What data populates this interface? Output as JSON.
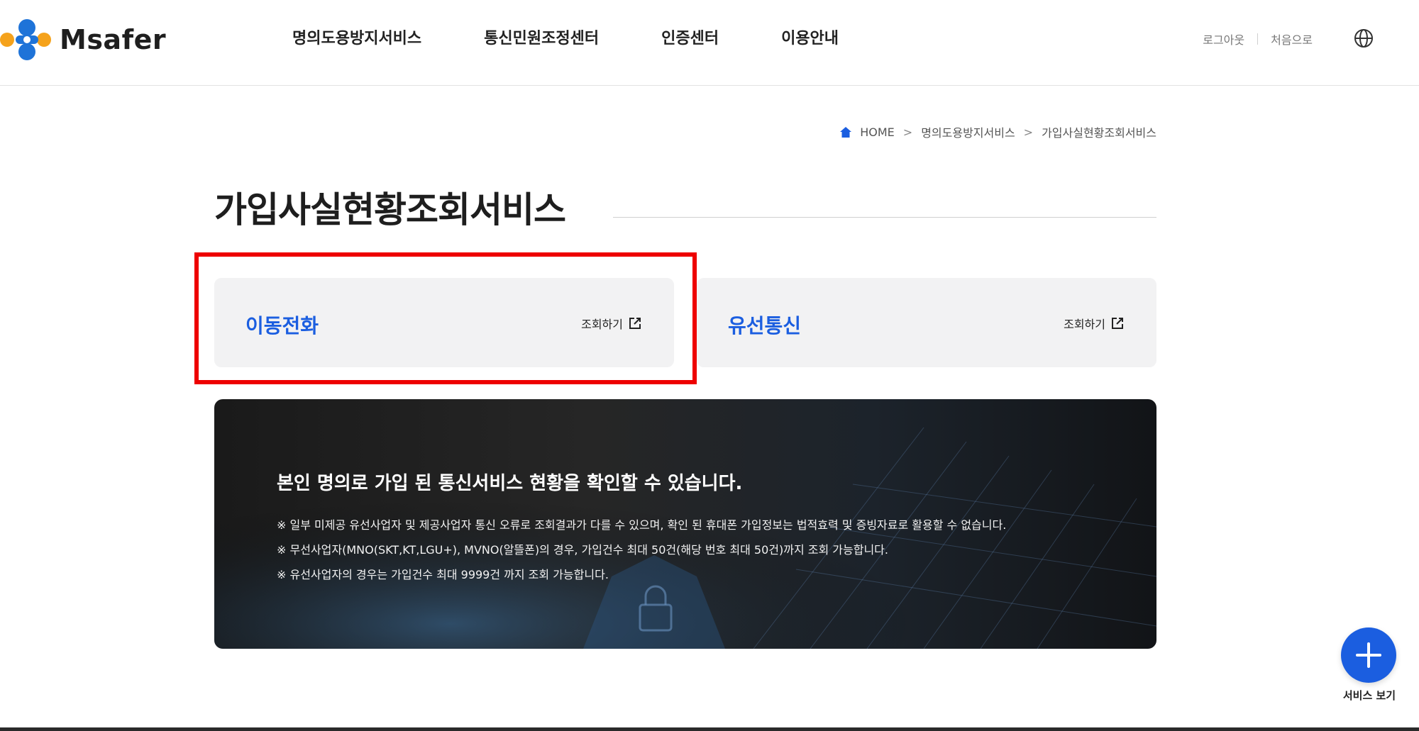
{
  "header": {
    "logo_text": "Msafer",
    "nav": [
      {
        "label": "명의도용방지서비스"
      },
      {
        "label": "통신민원조정센터"
      },
      {
        "label": "인증센터"
      },
      {
        "label": "이용안내"
      }
    ],
    "logout_label": "로그아웃",
    "home_label": "처음으로",
    "language_icon": "globe-icon"
  },
  "breadcrumb": {
    "home": "HOME",
    "level1": "명의도용방지서비스",
    "level2": "가입사실현황조회서비스",
    "separator": ">"
  },
  "page": {
    "title": "가입사실현황조회서비스"
  },
  "cards": [
    {
      "title": "이동전화",
      "link_label": "조회하기",
      "link_icon": "external-link-icon"
    },
    {
      "title": "유선통신",
      "link_label": "조회하기",
      "link_icon": "external-link-icon"
    }
  ],
  "banner": {
    "heading": "본인 명의로 가입 된 통신서비스 현황을 확인할 수 있습니다.",
    "notes": [
      "※ 일부 미제공 유선사업자 및 제공사업자 통신 오류로 조회결과가 다를 수 있으며, 확인 된 휴대폰 가입정보는 법적효력 및 증빙자료로 활용할 수 없습니다.",
      "※ 무선사업자(MNO(SKT,KT,LGU+), MVNO(알뜰폰)의 경우, 가입건수 최대 50건(해당 번호 최대 50건)까지 조회 가능합니다.",
      "※ 유선사업자의 경우는 가입건수 최대 9999건 까지 조회 가능합니다."
    ]
  },
  "fab": {
    "label": "서비스 보기",
    "icon": "plus-icon"
  },
  "colors": {
    "accent": "#1b5ee0",
    "highlight": "#ee0000",
    "card_bg": "#f2f2f3"
  }
}
